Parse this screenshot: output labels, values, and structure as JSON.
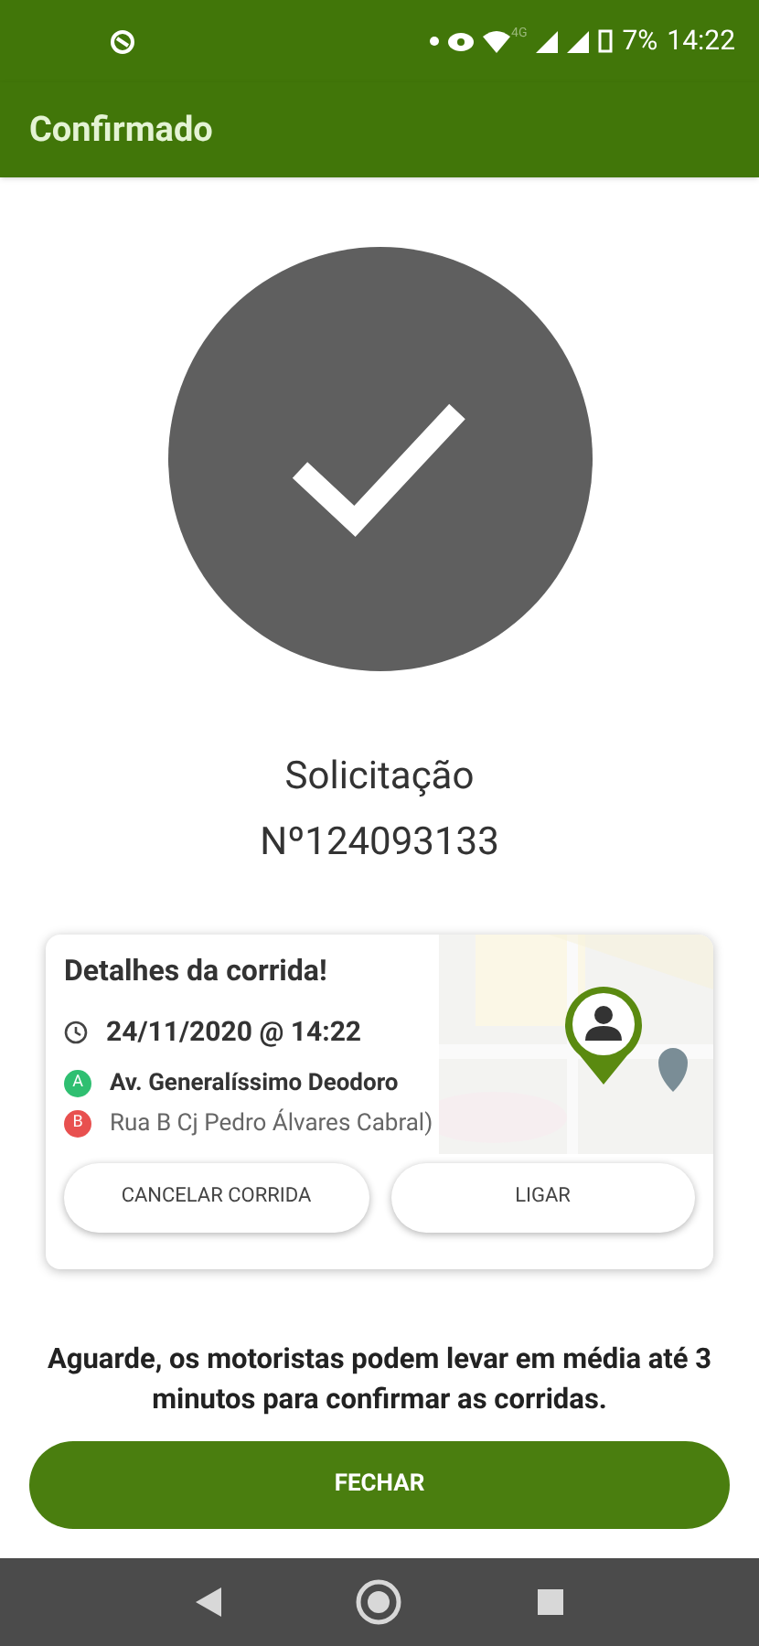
{
  "status_bar": {
    "network": "4G",
    "battery": "7%",
    "time": "14:22"
  },
  "app_bar": {
    "title": "Confirmado"
  },
  "request": {
    "label": "Solicitação",
    "number": "Nº124093133"
  },
  "ride_card": {
    "title": "Detalhes da corrida!",
    "datetime": "24/11/2020 @ 14:22",
    "stops": [
      {
        "marker": "A",
        "address": "Av. Generalíssimo Deodoro",
        "color": "#2fbf71"
      },
      {
        "marker": "B",
        "address": "Rua B Cj Pedro Álvares Cabral)",
        "color": "#e8504f"
      }
    ],
    "buttons": [
      "CANCELAR CORRIDA",
      "LIGAR"
    ]
  },
  "message": "Aguarde, os motoristas podem levar em média até 3 minutos para confirmar as corridas.",
  "close_button": "FECHAR"
}
